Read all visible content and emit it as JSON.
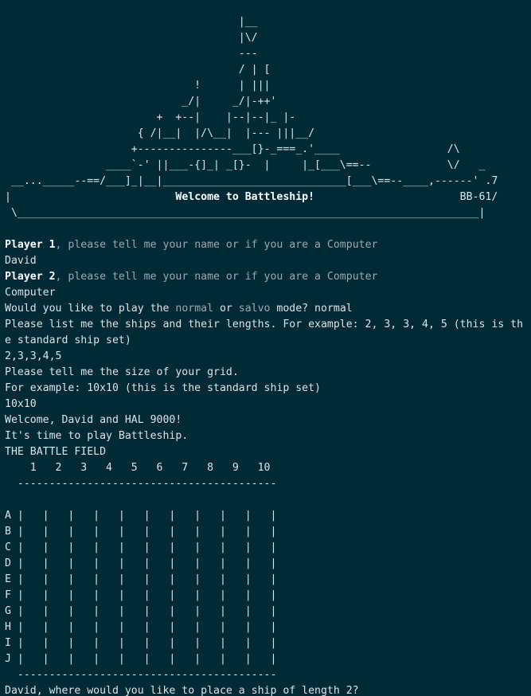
{
  "banner": [
    "                                     |__",
    "                                     |\\/",
    "                                     ---",
    "                                     / | [",
    "                              !      | |||",
    "                            _/|     _/|-++'",
    "                        +  +--|    |--|--|_ |-",
    "                     { /|__|  |/\\__|  |--- |||__/",
    "                    +---------------___[}-_===_.'____                 /\\",
    "                ____`-' ||___-{]_| _[}-  |     |_[___\\==--            \\/   _",
    " __..._____--==/___]_|__|_____________________________[___\\==--____,------' .7",
    "|                          Welcome to Battleship!                       BB-61/",
    " \\_________________________________________________________________________|"
  ],
  "lines": [
    {
      "parts": [
        {
          "t": "Player 1",
          "s": "hl"
        },
        {
          "t": ", please tell me your name or if you are a Computer",
          "s": "dim"
        }
      ]
    },
    {
      "parts": [
        {
          "t": "David",
          "s": ""
        }
      ]
    },
    {
      "parts": [
        {
          "t": "Player 2",
          "s": "hl"
        },
        {
          "t": ", please tell me your name or if you are a Computer",
          "s": "dim"
        }
      ]
    },
    {
      "parts": [
        {
          "t": "Computer",
          "s": ""
        }
      ]
    },
    {
      "parts": [
        {
          "t": "Would you like to play the ",
          "s": ""
        },
        {
          "t": "normal",
          "s": "dim"
        },
        {
          "t": " or ",
          "s": ""
        },
        {
          "t": "salvo",
          "s": "dim"
        },
        {
          "t": " mode? normal",
          "s": ""
        }
      ]
    },
    {
      "parts": [
        {
          "t": "Please list me the ships and their lengths. For example: 2, 3, 3, 4, 5 (this is th",
          "s": ""
        }
      ]
    },
    {
      "parts": [
        {
          "t": "e standard ship set)",
          "s": ""
        }
      ]
    },
    {
      "parts": [
        {
          "t": "2,3,3,4,5",
          "s": ""
        }
      ]
    },
    {
      "parts": [
        {
          "t": "Please tell me the size of your grid.",
          "s": ""
        }
      ]
    },
    {
      "parts": [
        {
          "t": "For example: 10x10 (this is the standard ship set)",
          "s": ""
        }
      ]
    },
    {
      "parts": [
        {
          "t": "10x10",
          "s": ""
        }
      ]
    },
    {
      "parts": [
        {
          "t": "Welcome, David and HAL 9000!",
          "s": ""
        }
      ]
    },
    {
      "parts": [
        {
          "t": "It's time to play Battleship.",
          "s": ""
        }
      ]
    },
    {
      "parts": [
        {
          "t": "THE BATTLE FIELD",
          "s": ""
        }
      ]
    }
  ],
  "grid": {
    "header": "    1   2   3   4   5   6   7   8   9   10",
    "rule": "  -----------------------------------------",
    "rows": [
      "A |   |   |   |   |   |   |   |   |   |   |",
      "B |   |   |   |   |   |   |   |   |   |   |",
      "C |   |   |   |   |   |   |   |   |   |   |",
      "D |   |   |   |   |   |   |   |   |   |   |",
      "E |   |   |   |   |   |   |   |   |   |   |",
      "F |   |   |   |   |   |   |   |   |   |   |",
      "G |   |   |   |   |   |   |   |   |   |   |",
      "H |   |   |   |   |   |   |   |   |   |   |",
      "I |   |   |   |   |   |   |   |   |   |   |",
      "J |   |   |   |   |   |   |   |   |   |   |"
    ]
  },
  "prompt": "David, where would you like to place a ship of length 2?"
}
